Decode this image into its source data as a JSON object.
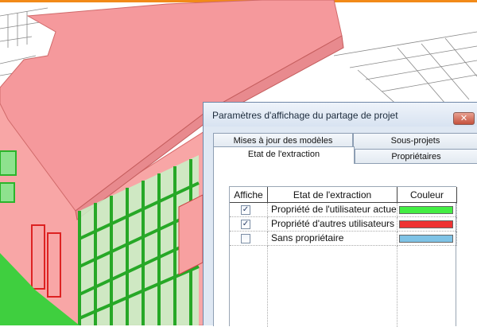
{
  "dialog": {
    "title": "Paramètres d'affichage du partage de projet",
    "close_glyph": "✕",
    "tabs_back": [
      "Mises à jour des modèles",
      "Sous-projets"
    ],
    "tabs_front": [
      "Etat de l'extraction",
      "Propriétaires"
    ],
    "active_tab": "Etat de l'extraction",
    "table": {
      "headers": [
        "Affiche",
        "Etat de l'extraction",
        "Couleur"
      ],
      "rows": [
        {
          "checked": true,
          "label": "Propriété de l'utilisateur actue",
          "color": "#44ee44"
        },
        {
          "checked": true,
          "label": "Propriété d'autres utilisateurs",
          "color": "#ee3333"
        },
        {
          "checked": false,
          "label": "Sans propriétaire",
          "color": "#7fc3e6"
        }
      ],
      "check_glyph": "✓"
    }
  },
  "scene": {
    "roof_color": "#f5999c",
    "wall_color": "#f8a6a6",
    "glazing_color": "#3cbf3c",
    "ground_color": "#3fcf3f",
    "accent_color": "#f28a18"
  }
}
